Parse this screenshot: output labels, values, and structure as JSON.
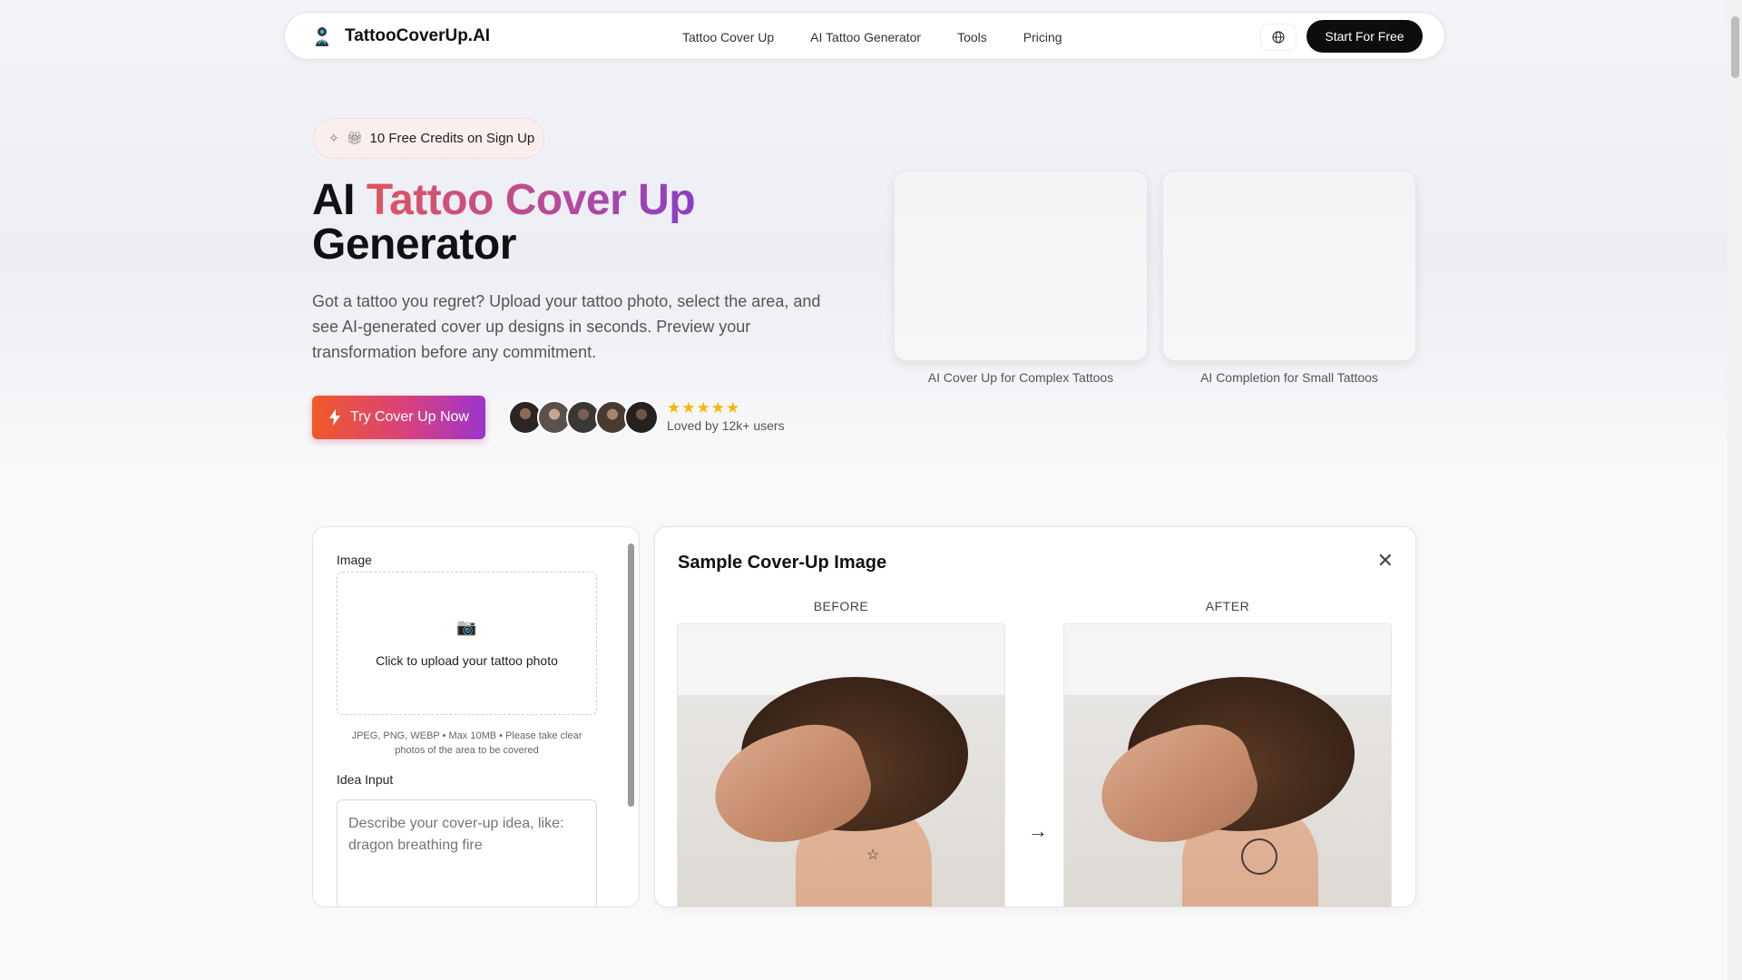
{
  "nav": {
    "logo_text": "TattooCoverUp.AI",
    "links": [
      "Tattoo Cover Up",
      "AI Tattoo Generator",
      "Tools",
      "Pricing"
    ],
    "cta": "Start For Free"
  },
  "hero": {
    "badge": "10 Free Credits on Sign Up",
    "title_prefix": "AI ",
    "title_highlight": "Tattoo Cover Up",
    "title_suffix": "Generator",
    "subtitle": "Got a tattoo you regret? Upload your tattoo photo, select the area, and see AI-generated cover up designs in seconds. Preview your transformation before any commitment.",
    "cta": "Try Cover Up Now",
    "stars": "★★★★★",
    "social_proof": "Loved by 12k+ users",
    "examples": [
      "AI Cover Up for Complex Tattoos",
      "AI Completion for Small Tattoos"
    ]
  },
  "form": {
    "image_label": "Image",
    "upload_text": "Click to upload your tattoo photo",
    "upload_hint": "JPEG, PNG, WEBP • Max 10MB • Please take clear photos of the area to be covered",
    "idea_label": "Idea Input",
    "idea_placeholder": "Describe your cover-up idea, like: dragon breathing fire"
  },
  "sample": {
    "title": "Sample Cover-Up Image",
    "before": "BEFORE",
    "after": "AFTER"
  },
  "colors": {
    "accent_start": "#f05a28",
    "accent_end": "#9a35cc",
    "star": "#f5b800",
    "primary_button": "#0d0d0d"
  }
}
